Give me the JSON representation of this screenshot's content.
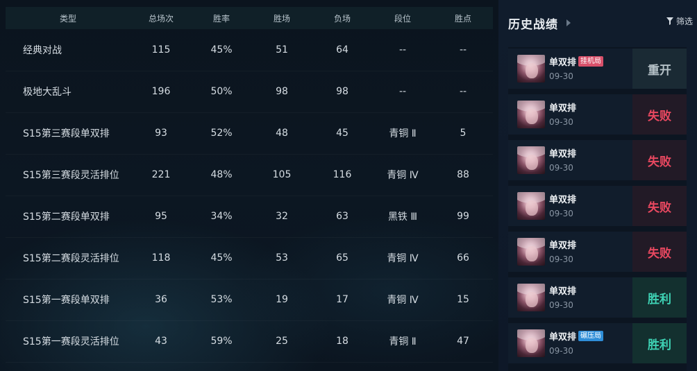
{
  "stats": {
    "headers": {
      "type": "类型",
      "total": "总场次",
      "winrate": "胜率",
      "wins": "胜场",
      "losses": "负场",
      "tier": "段位",
      "lp": "胜点"
    },
    "rows": [
      {
        "type": "经典对战",
        "total": "115",
        "winrate": "45%",
        "wins": "51",
        "losses": "64",
        "tier": "--",
        "lp": "--"
      },
      {
        "type": "极地大乱斗",
        "total": "196",
        "winrate": "50%",
        "wins": "98",
        "losses": "98",
        "tier": "--",
        "lp": "--"
      },
      {
        "type": "S15第三赛段单双排",
        "total": "93",
        "winrate": "52%",
        "wins": "48",
        "losses": "45",
        "tier": "青铜 Ⅱ",
        "lp": "5"
      },
      {
        "type": "S15第三赛段灵活排位",
        "total": "221",
        "winrate": "48%",
        "wins": "105",
        "losses": "116",
        "tier": "青铜 Ⅳ",
        "lp": "88"
      },
      {
        "type": "S15第二赛段单双排",
        "total": "95",
        "winrate": "34%",
        "wins": "32",
        "losses": "63",
        "tier": "黑铁 Ⅲ",
        "lp": "99"
      },
      {
        "type": "S15第二赛段灵活排位",
        "total": "118",
        "winrate": "45%",
        "wins": "53",
        "losses": "65",
        "tier": "青铜 Ⅳ",
        "lp": "66"
      },
      {
        "type": "S15第一赛段单双排",
        "total": "36",
        "winrate": "53%",
        "wins": "19",
        "losses": "17",
        "tier": "青铜 Ⅳ",
        "lp": "15"
      },
      {
        "type": "S15第一赛段灵活排位",
        "total": "43",
        "winrate": "59%",
        "wins": "25",
        "losses": "18",
        "tier": "青铜 Ⅱ",
        "lp": "47"
      }
    ]
  },
  "history": {
    "title": "历史战绩",
    "filter_label": "筛选",
    "colors": {
      "win": "#3ed2b4",
      "lose": "#e84860",
      "remake": "#b6c2c8",
      "tag_afk": "#d8506a",
      "tag_stomp": "#2f8ed8"
    },
    "matches": [
      {
        "queue": "单双排",
        "tag": "挂机局",
        "tag_kind": "red",
        "date": "09-30",
        "result": "重开",
        "result_kind": "remake",
        "avatar_icon": "champion-portrait-icon"
      },
      {
        "queue": "单双排",
        "tag": "",
        "tag_kind": "",
        "date": "09-30",
        "result": "失败",
        "result_kind": "lose",
        "avatar_icon": "champion-portrait-icon"
      },
      {
        "queue": "单双排",
        "tag": "",
        "tag_kind": "",
        "date": "09-30",
        "result": "失败",
        "result_kind": "lose",
        "avatar_icon": "champion-portrait-icon"
      },
      {
        "queue": "单双排",
        "tag": "",
        "tag_kind": "",
        "date": "09-30",
        "result": "失败",
        "result_kind": "lose",
        "avatar_icon": "champion-portrait-icon"
      },
      {
        "queue": "单双排",
        "tag": "",
        "tag_kind": "",
        "date": "09-30",
        "result": "失败",
        "result_kind": "lose",
        "avatar_icon": "champion-portrait-icon"
      },
      {
        "queue": "单双排",
        "tag": "",
        "tag_kind": "",
        "date": "09-30",
        "result": "胜利",
        "result_kind": "win",
        "avatar_icon": "champion-portrait-icon"
      },
      {
        "queue": "单双排",
        "tag": "碾压局",
        "tag_kind": "blue",
        "date": "09-30",
        "result": "胜利",
        "result_kind": "win",
        "avatar_icon": "champion-portrait-icon"
      }
    ]
  }
}
